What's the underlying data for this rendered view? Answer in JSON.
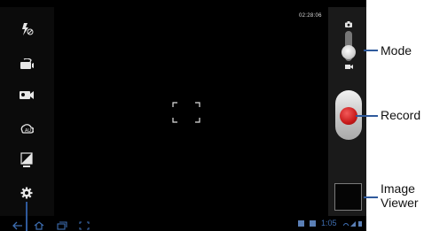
{
  "status": {
    "timer": "02:28:06",
    "clock": "1:05"
  },
  "left_toolbar": {
    "items": [
      {
        "name": "flash-off-icon"
      },
      {
        "name": "self-record-icon"
      },
      {
        "name": "recording-mode-icon"
      },
      {
        "name": "white-balance-icon"
      },
      {
        "name": "exposure-icon"
      },
      {
        "name": "settings-gear-icon"
      }
    ]
  },
  "callouts": {
    "mode": "Mode",
    "record": "Record",
    "image_viewer_line1": "Image",
    "image_viewer_line2": "Viewer"
  },
  "colors": {
    "record": "#c81a1a",
    "callout_line": "#2f5a9c",
    "nav": "#3d6db0"
  }
}
